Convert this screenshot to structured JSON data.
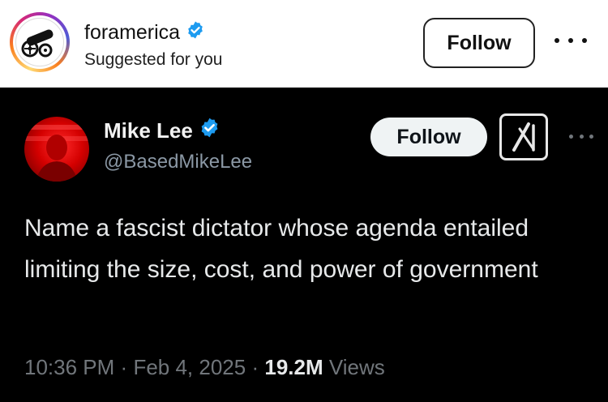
{
  "post_header": {
    "account_name": "foramerica",
    "subtitle": "Suggested for you",
    "follow_label": "Follow"
  },
  "tweet": {
    "author_name": "Mike Lee",
    "handle": "@BasedMikeLee",
    "follow_label": "Follow",
    "text": "Name a fascist dictator whose agenda entailed limiting the size, cost, and power of government",
    "time": "10:36 PM",
    "separator": "·",
    "date": "Feb 4, 2025",
    "views_count": "19.2M",
    "views_label": "Views"
  },
  "icons": {
    "verified": "verified-badge-icon",
    "more": "more-options-icon",
    "grok": "grok-icon"
  },
  "colors": {
    "verified_blue": "#1d9bf0",
    "tweet_bg": "#000000"
  }
}
